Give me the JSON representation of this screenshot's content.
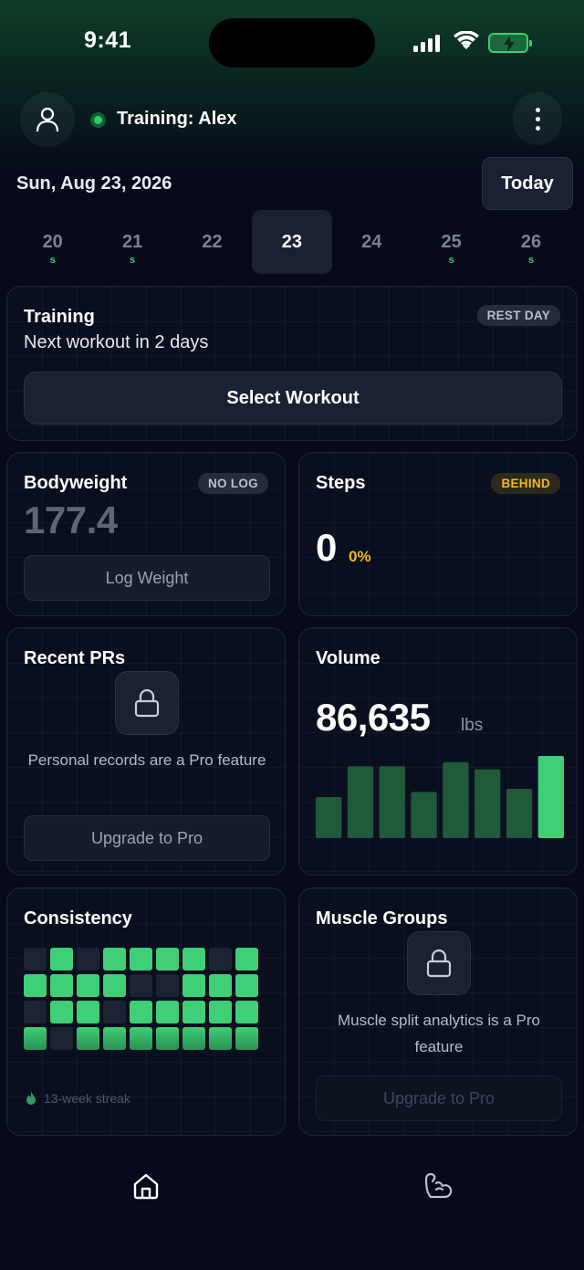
{
  "status_bar": {
    "time": "9:41"
  },
  "header": {
    "training_label": "Training: Alex"
  },
  "date": {
    "label": "Sun, Aug 23, 2026",
    "today_button": "Today"
  },
  "week": [
    {
      "num": "20",
      "mark": "s",
      "active": false
    },
    {
      "num": "21",
      "mark": "s",
      "active": false
    },
    {
      "num": "22",
      "mark": "",
      "active": false
    },
    {
      "num": "23",
      "mark": "",
      "active": true
    },
    {
      "num": "24",
      "mark": "",
      "active": false
    },
    {
      "num": "25",
      "mark": "s",
      "active": false
    },
    {
      "num": "26",
      "mark": "s",
      "active": false
    }
  ],
  "training": {
    "title": "Training",
    "subtitle": "Next workout in 2 days",
    "badge": "REST DAY",
    "button": "Select Workout"
  },
  "bodyweight": {
    "title": "Bodyweight",
    "badge": "NO LOG",
    "value": "177.4",
    "button": "Log Weight"
  },
  "steps": {
    "title": "Steps",
    "badge": "BEHIND",
    "value": "0",
    "percent": "0%"
  },
  "recent_prs": {
    "title": "Recent PRs",
    "text": "Personal records are a Pro feature",
    "button": "Upgrade to Pro"
  },
  "volume": {
    "title": "Volume",
    "value": "86,635",
    "unit": "lbs"
  },
  "chart_data": {
    "type": "bar",
    "categories": [
      "1",
      "2",
      "3",
      "4",
      "5",
      "6",
      "7",
      "8"
    ],
    "values": [
      40,
      70,
      70,
      45,
      74,
      67,
      48,
      80
    ],
    "highlight_last": true,
    "ylim": [
      0,
      80
    ],
    "title": "",
    "xlabel": "",
    "ylabel": ""
  },
  "consistency": {
    "title": "Consistency",
    "streak": "13-week streak",
    "grid": [
      [
        0,
        1,
        0,
        1,
        1,
        1,
        1,
        0,
        1
      ],
      [
        1,
        1,
        1,
        1,
        0,
        0,
        1,
        1,
        1
      ],
      [
        0,
        1,
        1,
        0,
        1,
        1,
        1,
        1,
        1
      ],
      [
        1,
        0,
        1,
        1,
        1,
        1,
        1,
        1,
        1
      ]
    ]
  },
  "muscle_groups": {
    "title": "Muscle Groups",
    "text": "Muscle split analytics is a Pro feature",
    "button": "Upgrade to Pro"
  },
  "nav": {
    "home_icon": "home-icon",
    "workout_icon": "bicep-icon"
  },
  "colors": {
    "accent_green": "#3fcf76",
    "bar_dim": "#1f5a3a",
    "warning": "#f5b91c",
    "background": "#060a1a"
  }
}
